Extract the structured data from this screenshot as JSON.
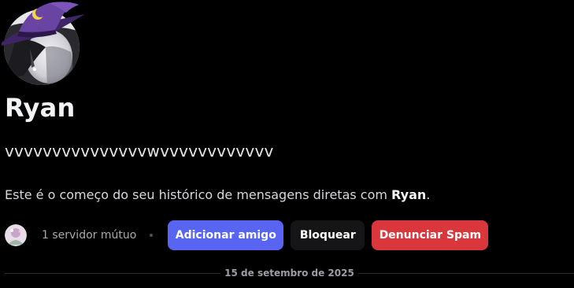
{
  "profile": {
    "display_name": "Ryan",
    "username": "vvvvvvvvvvvvvvvwvvvvvvvvvvvv",
    "intro_prefix": "Este é o começo do seu histórico de mensagens diretas com ",
    "intro_name": "Ryan",
    "intro_suffix": "."
  },
  "mutual": {
    "text": "1 servidor mútuo"
  },
  "buttons": {
    "add_friend": "Adicionar amigo",
    "block": "Bloquear",
    "report_spam": "Denunciar Spam"
  },
  "divider": {
    "date": "15 de setembro de 2025"
  },
  "colors": {
    "background": "#000000",
    "primary": "#5865f2",
    "secondary": "#151517",
    "danger": "#da373c",
    "hat": "#5b3a8c"
  },
  "icons": {
    "avatar": "witch-hat-avatar",
    "mutual_avatar": "server-icon"
  }
}
